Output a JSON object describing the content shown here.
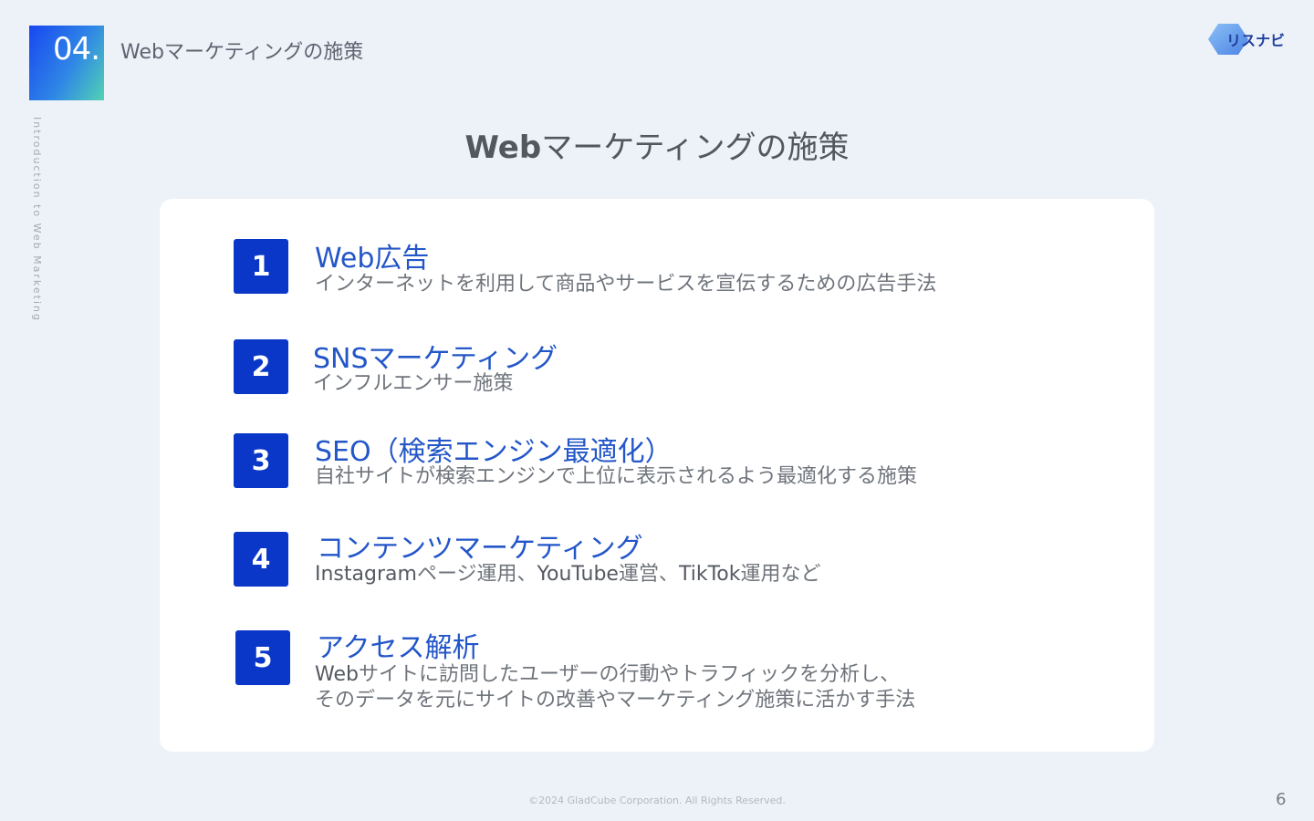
{
  "header": {
    "section_number": "04.",
    "section_title": "Webマーケティングの施策",
    "vertical_caption": "Introduction to Web Marketing",
    "logo_text": "リスナビ"
  },
  "slide": {
    "title_latin": "Web",
    "title_rest": "マーケティングの施策"
  },
  "items": [
    {
      "number": "1",
      "title": "Web広告",
      "description": "インターネットを利用して商品やサービスを宣伝するための広告手法"
    },
    {
      "number": "2",
      "title": "SNSマーケティング",
      "description": "インフルエンサー施策"
    },
    {
      "number": "3",
      "title": "SEO（検索エンジン最適化）",
      "description": "自社サイトが検索エンジンで上位に表示されるよう最適化する施策"
    },
    {
      "number": "4",
      "title": "コンテンツマーケティング",
      "description_parts": [
        "Instagram",
        "ページ運用、",
        "YouTube",
        "運営、",
        "TikTok",
        "運用など"
      ]
    },
    {
      "number": "5",
      "title": "アクセス解析",
      "description_line1_latin": "Web",
      "description_line1_rest": "サイトに訪問したユーザーの行動やトラフィックを分析し、",
      "description_line2": "そのデータを元にサイトの改善やマーケティング施策に活かす手法"
    }
  ],
  "footer": {
    "copyright": "©2024 GladCube Corporation. All Rights Reserved.",
    "page_number": "6"
  },
  "colors": {
    "background": "#edf2f9",
    "accent_blue": "#0b37c9",
    "title_blue": "#2356c8",
    "badge_gradient": [
      "#1847f0",
      "#52d2b4"
    ]
  }
}
